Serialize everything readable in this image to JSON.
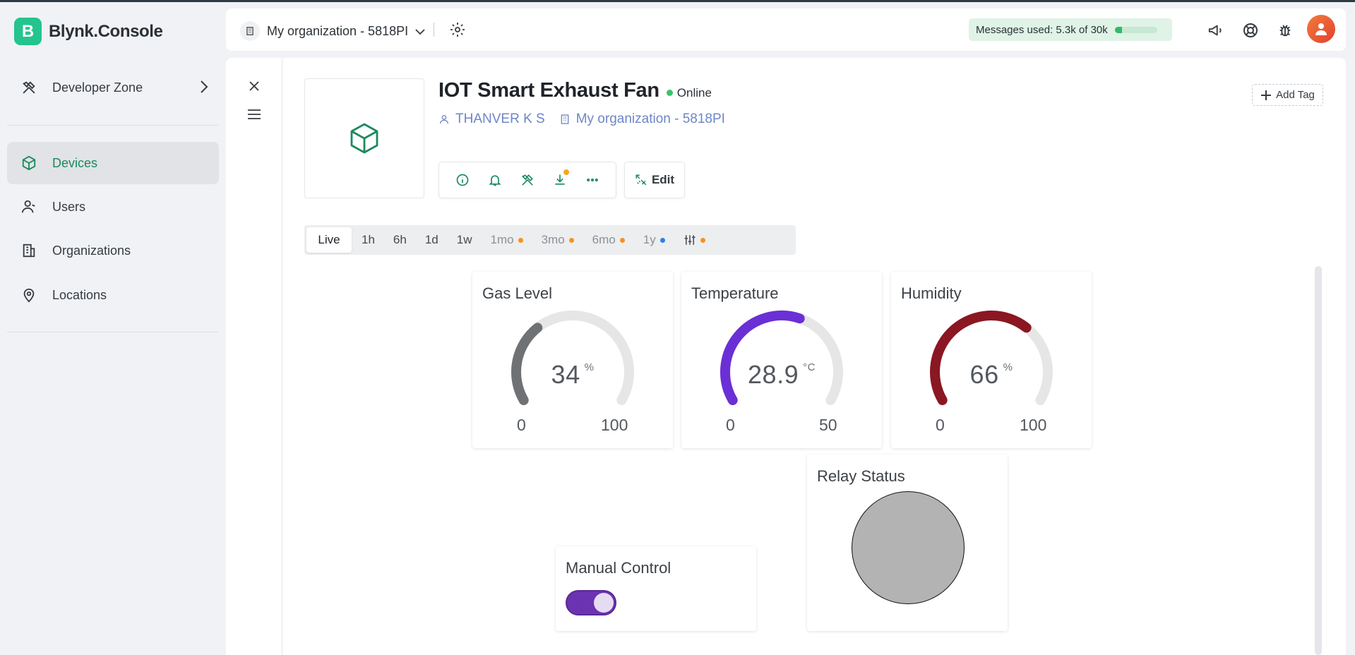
{
  "brand": {
    "logo_letter": "B",
    "name": "Blynk.Console"
  },
  "sidebar": {
    "developer_zone": "Developer Zone",
    "items": [
      {
        "label": "Devices",
        "icon": "cube-icon",
        "active": true
      },
      {
        "label": "Users",
        "icon": "users-icon",
        "active": false
      },
      {
        "label": "Organizations",
        "icon": "building-icon",
        "active": false
      },
      {
        "label": "Locations",
        "icon": "location-pin-icon",
        "active": false
      }
    ]
  },
  "topbar": {
    "org_name": "My organization - 5818PI",
    "messages_label": "Messages used: 5.3k of 30k",
    "messages_used_fraction": 0.177
  },
  "device": {
    "name": "IOT Smart Exhaust Fan",
    "status": "Online",
    "owner": "THANVER K S",
    "organization": "My organization - 5818PI",
    "edit_label": "Edit",
    "add_tag_label": "Add Tag"
  },
  "time_tabs": [
    {
      "label": "Live",
      "active": true,
      "dot": null
    },
    {
      "label": "1h",
      "active": false,
      "dot": null
    },
    {
      "label": "6h",
      "active": false,
      "dot": null
    },
    {
      "label": "1d",
      "active": false,
      "dot": null
    },
    {
      "label": "1w",
      "active": false,
      "dot": null
    },
    {
      "label": "1mo",
      "active": false,
      "dot": "#f5931e"
    },
    {
      "label": "3mo",
      "active": false,
      "dot": "#f5931e"
    },
    {
      "label": "6mo",
      "active": false,
      "dot": "#f5931e"
    },
    {
      "label": "1y",
      "active": false,
      "dot": "#2f7fe8"
    }
  ],
  "widgets": {
    "gas": {
      "title": "Gas Level",
      "value": "34",
      "unit": "%",
      "min": "0",
      "max": "100",
      "fraction": 0.34,
      "color": "#6f7275"
    },
    "temperature": {
      "title": "Temperature",
      "value": "28.9",
      "unit": "°C",
      "min": "0",
      "max": "50",
      "fraction": 0.578,
      "color": "#6b2fd6"
    },
    "humidity": {
      "title": "Humidity",
      "value": "66",
      "unit": "%",
      "min": "0",
      "max": "100",
      "fraction": 0.66,
      "color": "#8a1721"
    },
    "manual_control": {
      "title": "Manual Control",
      "on": true
    },
    "relay_status": {
      "title": "Relay Status"
    }
  }
}
